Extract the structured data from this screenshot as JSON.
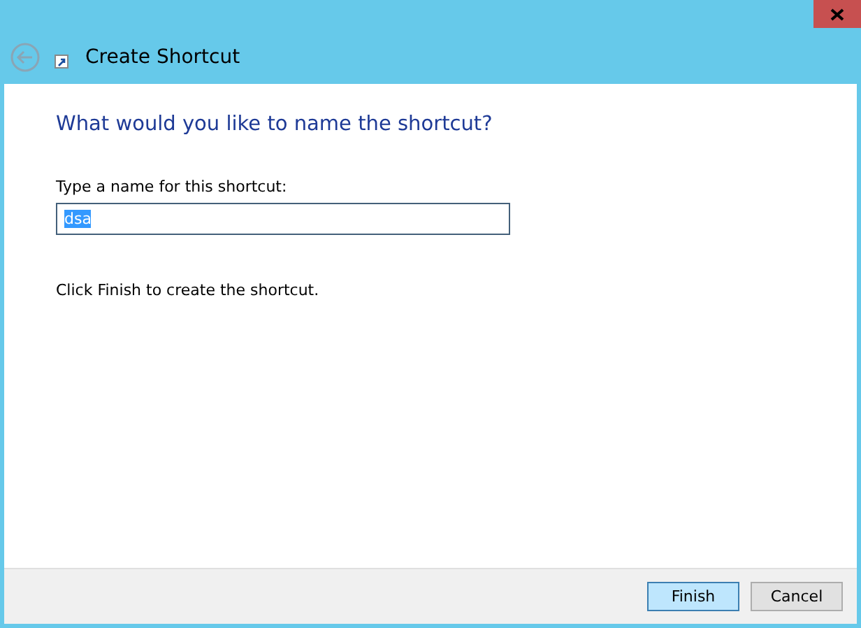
{
  "window": {
    "title": "Create Shortcut",
    "back_disabled": true
  },
  "heading": "What would you like to name the shortcut?",
  "name_field": {
    "label": "Type a name for this shortcut:",
    "value": "dsa",
    "value_selected": true
  },
  "instruction": "Click Finish to create the shortcut.",
  "buttons": [
    {
      "label": "Finish",
      "default": true
    },
    {
      "label": "Cancel",
      "default": false
    }
  ]
}
